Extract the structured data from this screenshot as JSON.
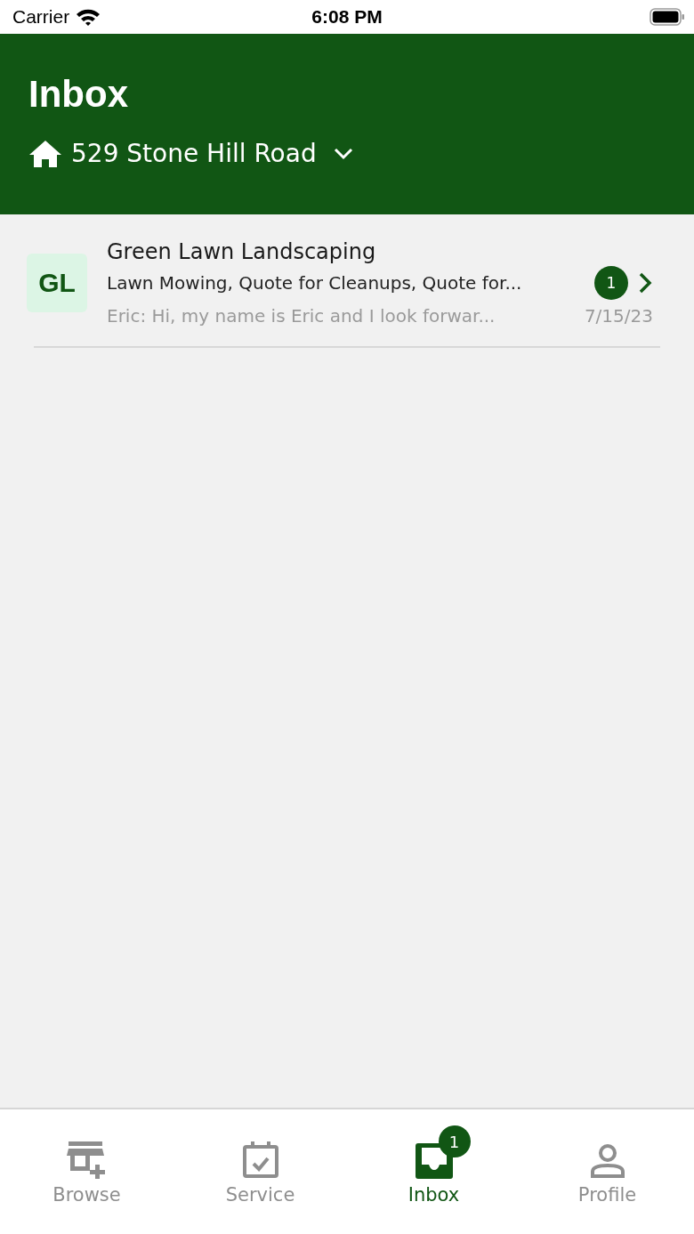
{
  "status_bar": {
    "carrier": "Carrier",
    "time": "6:08 PM"
  },
  "header": {
    "title": "Inbox",
    "address": "529 Stone Hill Road"
  },
  "conversations": [
    {
      "initials": "GL",
      "name": "Green Lawn Landscaping",
      "services": "Lawn Mowing, Quote for Cleanups, Quote for...",
      "preview": "Eric: Hi, my name is Eric and I look forwar...",
      "date": "7/15/23",
      "unread": "1"
    }
  ],
  "tabs": [
    {
      "kind": "browse",
      "label": "Browse",
      "selected": false
    },
    {
      "kind": "service",
      "label": "Service",
      "selected": false
    },
    {
      "kind": "inbox",
      "label": "Inbox",
      "selected": true,
      "badge": "1"
    },
    {
      "kind": "profile",
      "label": "Profile",
      "selected": false
    }
  ]
}
